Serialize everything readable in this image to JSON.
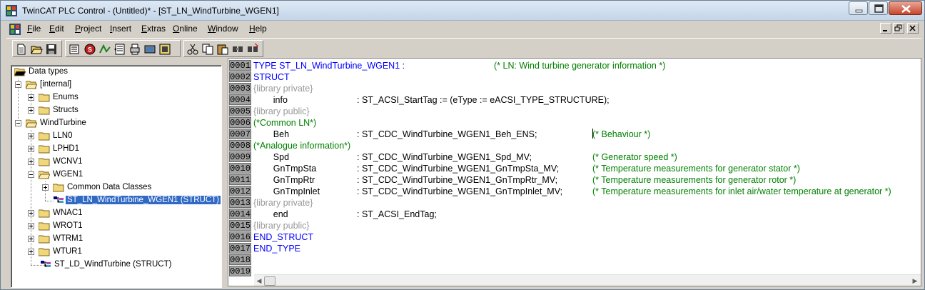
{
  "window": {
    "title": "TwinCAT PLC Control - (Untitled)* - [ST_LN_WindTurbine_WGEN1]",
    "min_label": "minimize",
    "max_label": "maximize",
    "close_label": "close"
  },
  "menu": {
    "items": [
      {
        "u": "F",
        "rest": "ile"
      },
      {
        "u": "E",
        "rest": "dit"
      },
      {
        "u": "P",
        "rest": "roject"
      },
      {
        "u": "I",
        "rest": "nsert"
      },
      {
        "u": "E",
        "rest": "xtras"
      },
      {
        "u": "O",
        "rest": "nline"
      },
      {
        "u": "W",
        "rest": "indow"
      },
      {
        "u": "H",
        "rest": "elp"
      }
    ]
  },
  "toolbar": {
    "icons": [
      "new-file-icon",
      "open-file-icon",
      "save-icon",
      "compile-icon",
      "stop-icon",
      "run-icon",
      "step-icon",
      "print-icon",
      "login-icon",
      "cut-icon",
      "copy-icon",
      "paste-icon",
      "find-icon",
      "replace-icon"
    ]
  },
  "tree": {
    "root": "Data types",
    "internal": "[internal]",
    "enums": "Enums",
    "structs": "Structs",
    "windturbine": "WindTurbine",
    "lln0": "LLN0",
    "lphd1": "LPHD1",
    "wcnv1": "WCNV1",
    "wgen1": "WGEN1",
    "common_data_classes": "Common Data Classes",
    "selected_struct": "ST_LN_WindTurbine_WGEN1 (STRUCT)",
    "wnac1": "WNAC1",
    "wrot1": "WROT1",
    "wtrm1": "WTRM1",
    "wtur1": "WTUR1",
    "ld_struct": "ST_LD_WindTurbine (STRUCT)"
  },
  "editor": {
    "lines": [
      {
        "num": "0001",
        "a": "TYPE ST_LN_WindTurbine_WGEN1 :",
        "a_cls": "kw",
        "b": "",
        "c": "(* LN: Wind turbine generator information *)"
      },
      {
        "num": "0002",
        "a": "STRUCT",
        "a_cls": "kw",
        "b": "",
        "c": ""
      },
      {
        "num": "0003",
        "a": "{library private}",
        "a_cls": "gry",
        "b": "",
        "c": ""
      },
      {
        "num": "0004",
        "a": "        info",
        "a_cls": "",
        "b": ": ST_ACSI_StartTag := (eType :=  eACSI_TYPE_STRUCTURE);",
        "c": ""
      },
      {
        "num": "0005",
        "a": "{library public}",
        "a_cls": "gry",
        "b": "",
        "c": ""
      },
      {
        "num": "0006",
        "a": "(*Common LN*)",
        "a_cls": "cmt",
        "b": "",
        "c": ""
      },
      {
        "num": "0007",
        "a": "        Beh",
        "a_cls": "",
        "b": ": ST_CDC_WindTurbine_WGEN1_Beh_ENS;",
        "c": "(* Behaviour *)"
      },
      {
        "num": "0008",
        "a": "(*Analogue information*)",
        "a_cls": "cmt",
        "b": "",
        "c": ""
      },
      {
        "num": "0009",
        "a": "        Spd",
        "a_cls": "",
        "b": ": ST_CDC_WindTurbine_WGEN1_Spd_MV;",
        "c": "(* Generator speed *)"
      },
      {
        "num": "0010",
        "a": "        GnTmpSta",
        "a_cls": "",
        "b": ": ST_CDC_WindTurbine_WGEN1_GnTmpSta_MV;",
        "c": "(* Temperature measurements for generator stator *)"
      },
      {
        "num": "0011",
        "a": "        GnTmpRtr",
        "a_cls": "",
        "b": ": ST_CDC_WindTurbine_WGEN1_GnTmpRtr_MV;",
        "c": "(* Temperature measurements for generator rotor *)"
      },
      {
        "num": "0012",
        "a": "        GnTmpInlet",
        "a_cls": "",
        "b": ": ST_CDC_WindTurbine_WGEN1_GnTmpInlet_MV;",
        "c": "(* Temperature measurements for inlet air/water temperature at generator *)"
      },
      {
        "num": "0013",
        "a": "{library private}",
        "a_cls": "gry",
        "b": "",
        "c": ""
      },
      {
        "num": "0014",
        "a": "        end",
        "a_cls": "",
        "b": ": ST_ACSI_EndTag;",
        "c": ""
      },
      {
        "num": "0015",
        "a": "{library public}",
        "a_cls": "gry",
        "b": "",
        "c": ""
      },
      {
        "num": "0016",
        "a": "END_STRUCT",
        "a_cls": "kw",
        "b": "",
        "c": ""
      },
      {
        "num": "0017",
        "a": "END_TYPE",
        "a_cls": "kw",
        "b": "",
        "c": ""
      },
      {
        "num": "0018",
        "a": "",
        "a_cls": "",
        "b": "",
        "c": ""
      },
      {
        "num": "0019",
        "a": "",
        "a_cls": "",
        "b": "",
        "c": ""
      }
    ]
  }
}
